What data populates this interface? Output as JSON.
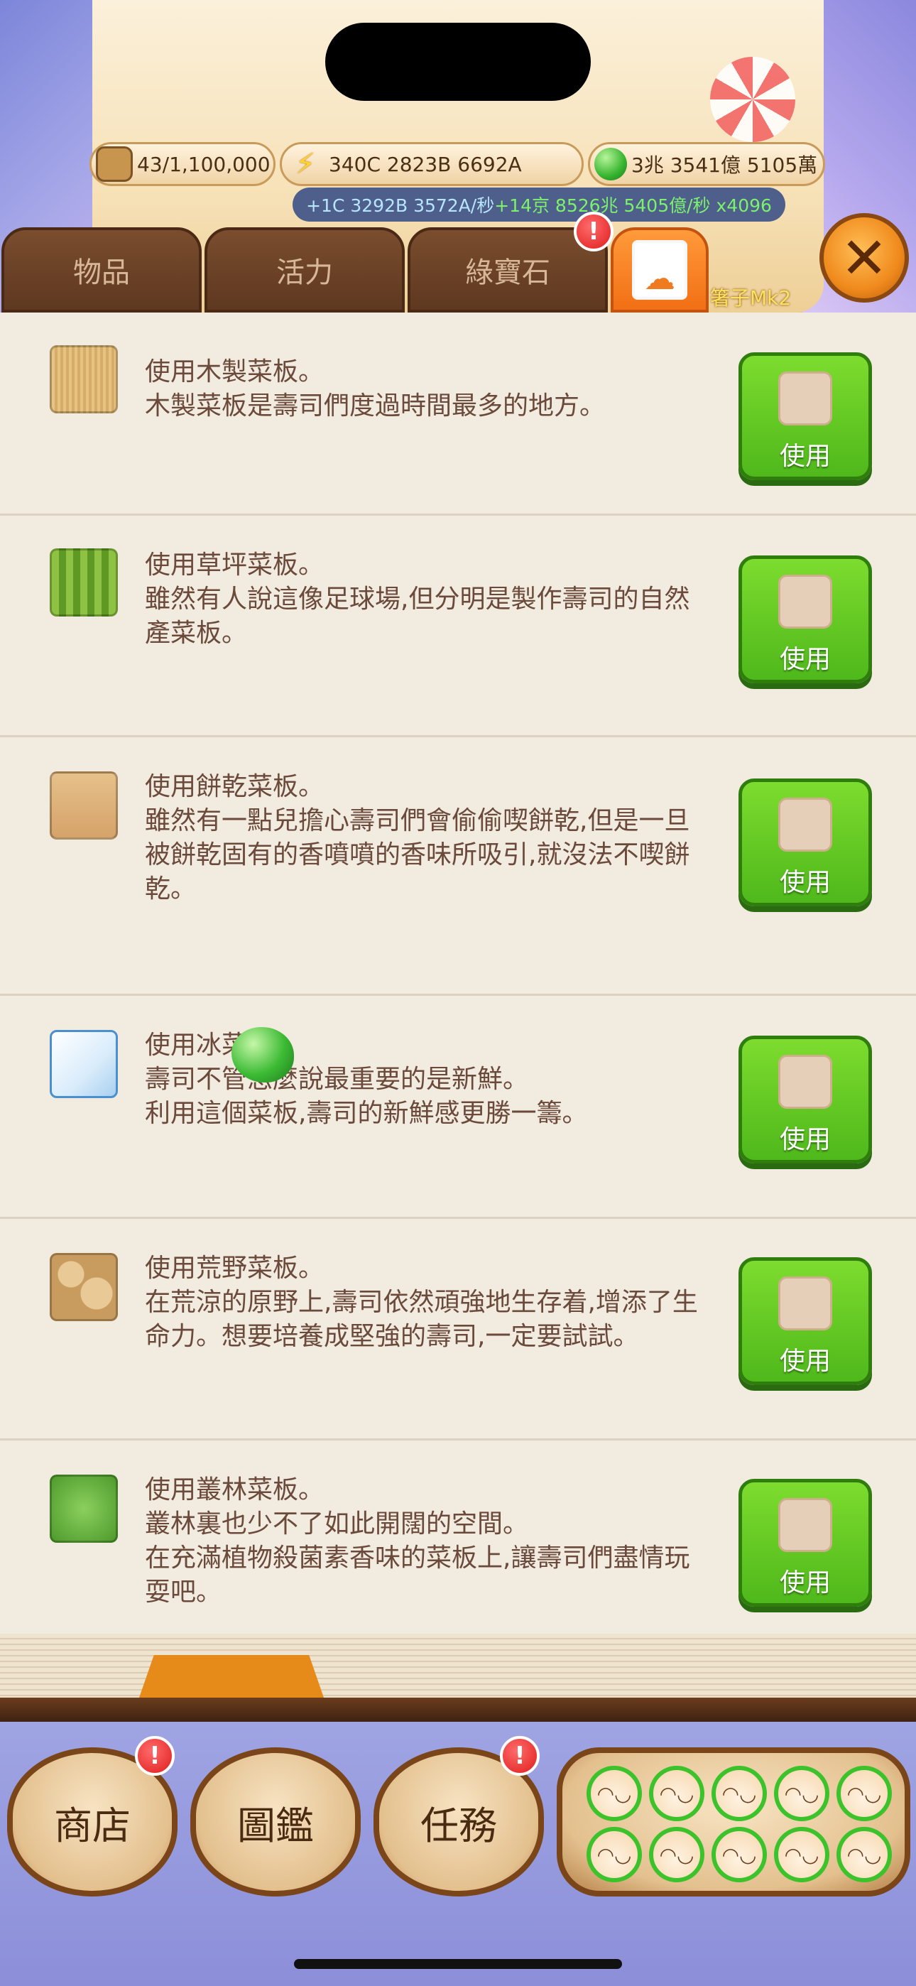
{
  "resources": {
    "bread": "43/1,100,000",
    "energy": "340C 2823B 6692A",
    "gems": "3兆 3541億 5105萬"
  },
  "rate": {
    "energy_rate": "+1C 3292B 3572A/秒",
    "gem_rate": "+14京 8526兆 5405億/秒 x4096"
  },
  "tabs": [
    {
      "label": "物品"
    },
    {
      "label": "活力"
    },
    {
      "label": "綠寶石"
    },
    {
      "label": ""
    }
  ],
  "tab_badge": "!",
  "player_tag": "箸子Mk2",
  "close_icon": "✕",
  "items": [
    {
      "icon": "wood-board-icon",
      "text": "使用木製菜板。\n木製菜板是壽司們度過時間最多的地方。",
      "button": "使用"
    },
    {
      "icon": "grass-board-icon",
      "text": "使用草坪菜板。\n雖然有人說這像足球場,但分明是製作壽司的自然產菜板。",
      "button": "使用"
    },
    {
      "icon": "biscuit-board-icon",
      "text": "使用餅乾菜板。\n雖然有一點兒擔心壽司們會偷偷喫餅乾,但是一旦被餅乾固有的香噴噴的香味所吸引,就沒法不喫餅乾。",
      "button": "使用"
    },
    {
      "icon": "ice-board-icon",
      "text": "使用冰菜板。\n壽司不管怎麼說最重要的是新鮮。\n利用這個菜板,壽司的新鮮感更勝一籌。",
      "button": "使用"
    },
    {
      "icon": "wild-board-icon",
      "text": "使用荒野菜板。\n在荒涼的原野上,壽司依然頑強地生存着,增添了生命力。想要培養成堅強的壽司,一定要試試。",
      "button": "使用"
    },
    {
      "icon": "jungle-board-icon",
      "text": "使用叢林菜板。\n叢林裏也少不了如此開闊的空間。\n在充滿植物殺菌素香味的菜板上,讓壽司們盡情玩耍吧。",
      "button": "使用"
    }
  ],
  "bottom_nav": [
    {
      "label": "商店",
      "badge": "!"
    },
    {
      "label": "圖鑑",
      "badge": ""
    },
    {
      "label": "任務",
      "badge": "!"
    }
  ],
  "characters_count": 10
}
